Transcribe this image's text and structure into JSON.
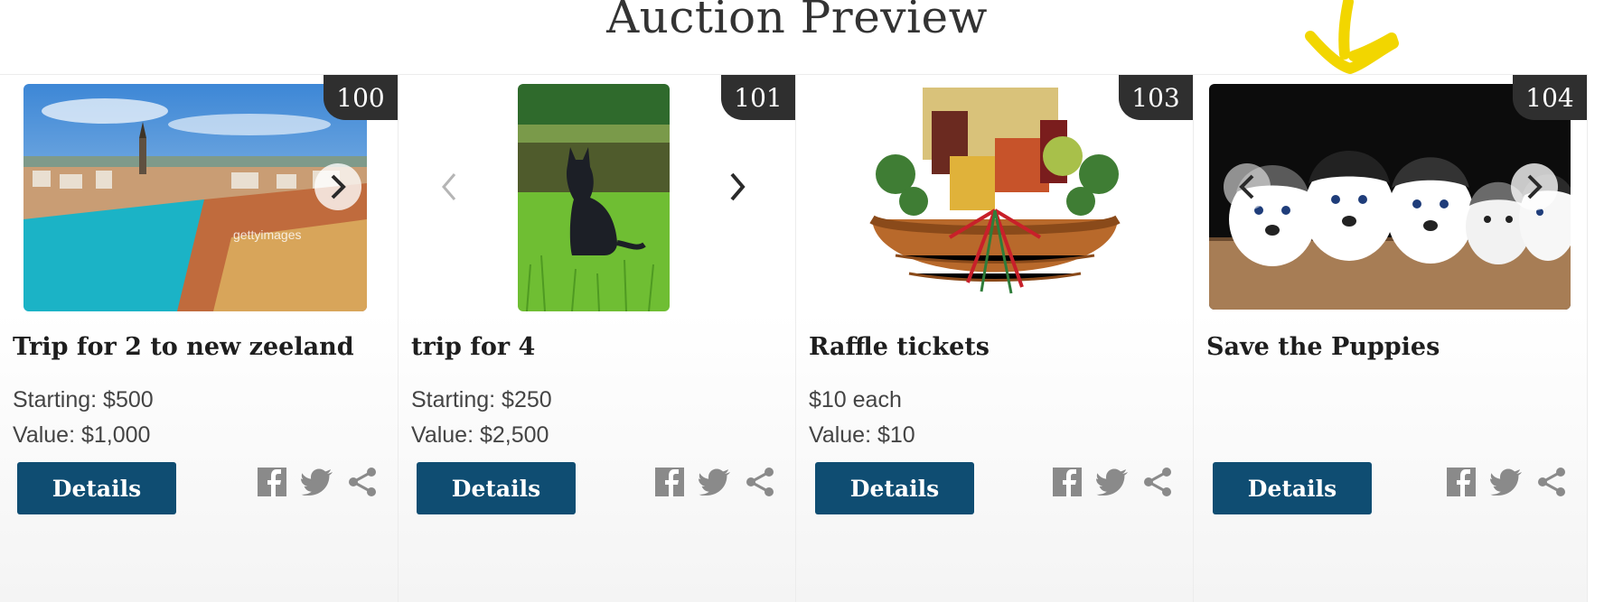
{
  "page": {
    "title": "Auction Preview"
  },
  "colors": {
    "button": "#0f4d72",
    "badge": "#2f2f2f",
    "share_icons": "#8a8a8a",
    "annotation": "#f2d600"
  },
  "icons": {
    "next": "chevron-right-icon",
    "prev": "chevron-left-icon",
    "facebook": "facebook-icon",
    "twitter": "twitter-icon",
    "share": "share-icon"
  },
  "items": [
    {
      "lot": "100",
      "title": "Trip for 2 to new zeeland",
      "line1": "Starting: $500",
      "line2": "Value: $1,000",
      "button": "Details",
      "photo_watermark": "gettyimages"
    },
    {
      "lot": "101",
      "title": "trip for 4",
      "line1": "Starting: $250",
      "line2": "Value: $2,500",
      "button": "Details"
    },
    {
      "lot": "103",
      "title": "Raffle tickets",
      "line1": "$10 each",
      "line2": "Value: $10",
      "button": "Details"
    },
    {
      "lot": "104",
      "title": "Save the Puppies",
      "line1": "",
      "line2": "",
      "button": "Details"
    }
  ]
}
